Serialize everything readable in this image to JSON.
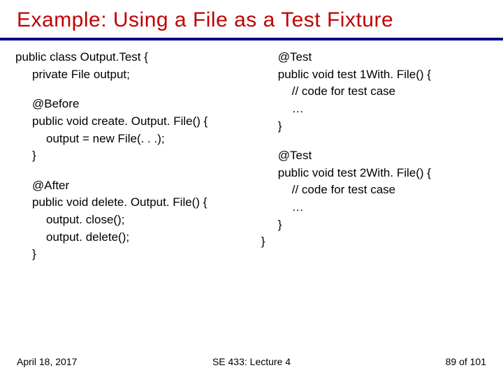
{
  "title": "Example:  Using a File as a Test Fixture",
  "left": {
    "block1": {
      "l1": "public class Output.Test {",
      "l2": "private File output;"
    },
    "block2": {
      "l1": "@Before",
      "l2": "public void create. Output. File() {",
      "l3": "output = new File(. . .);",
      "l4": "}"
    },
    "block3": {
      "l1": "@After",
      "l2": "public void delete. Output. File() {",
      "l3": "output. close();",
      "l4": "output. delete();",
      "l5": "}"
    }
  },
  "right": {
    "block1": {
      "l1": "@Test",
      "l2": "public void test 1With. File() {",
      "l3": "// code for test case",
      "l4": "…",
      "l5": "}"
    },
    "block2": {
      "l1": "@Test",
      "l2": "public void test 2With. File() {",
      "l3": "// code for test case",
      "l4": "…",
      "l5": "}",
      "l6": "}"
    }
  },
  "footer": {
    "date": "April 18, 2017",
    "center": "SE 433: Lecture 4",
    "page": "89 of 101"
  }
}
